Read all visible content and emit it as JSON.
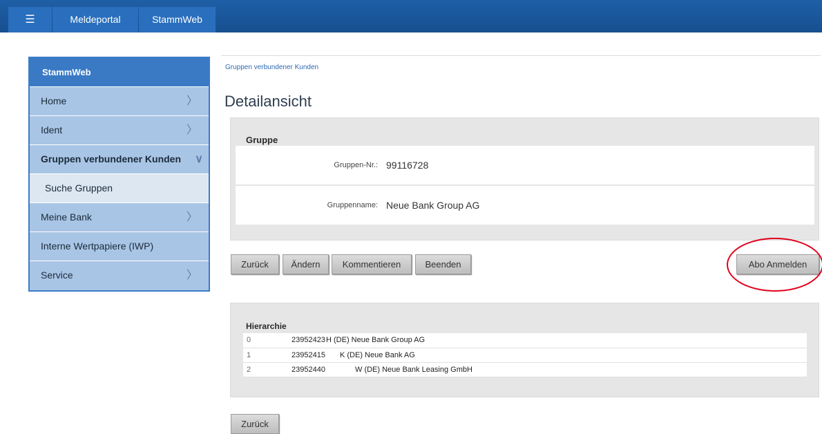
{
  "topbar": {
    "menu_icon": "☰",
    "nav_items": [
      "Meldeportal",
      "StammWeb"
    ]
  },
  "sidebar": {
    "title": "StammWeb",
    "items": [
      {
        "label": "Home",
        "icon": "chevron-right"
      },
      {
        "label": "Ident",
        "icon": "chevron-right"
      },
      {
        "label": "Gruppen verbundener Kunden",
        "icon": "chevron-down"
      },
      {
        "label": "Suche Gruppen"
      },
      {
        "label": "Meine Bank",
        "icon": "chevron-right"
      },
      {
        "label": "Interne Wertpapiere (IWP)"
      },
      {
        "label": "Service",
        "icon": "chevron-right"
      }
    ]
  },
  "main": {
    "breadcrumb": "Gruppen verbundener Kunden",
    "title": "Detailansicht",
    "group": {
      "title": "Gruppe",
      "fields": [
        {
          "label": "Gruppen-Nr.:",
          "value": "99116728"
        },
        {
          "label": "Gruppenname:",
          "value": "Neue Bank Group AG"
        }
      ]
    },
    "actions": {
      "back": "Zurück",
      "edit": "Ändern",
      "comment": "Kommentieren",
      "end": "Beenden",
      "subscribe": "Abo Anmelden"
    },
    "hierarchy": {
      "title": "Hierarchie",
      "rows": [
        {
          "level": "0",
          "number": "23952423",
          "name": "H (DE) Neue Bank Group AG"
        },
        {
          "level": "1",
          "number": "23952415",
          "name": "K (DE) Neue Bank AG"
        },
        {
          "level": "2",
          "number": "23952440",
          "name": "W (DE) Neue Bank Leasing GmbH"
        }
      ]
    },
    "footer_back": "Zurück"
  },
  "colors": {
    "topbar": "#1f5fa6",
    "sidebar": "#a9c5e6",
    "sidebar_header": "#3a7ac4",
    "highlight_ellipse": "#e0001b"
  }
}
